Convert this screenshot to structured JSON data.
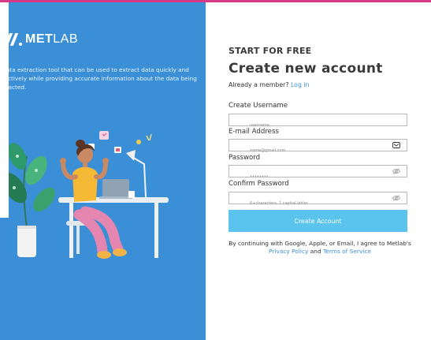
{
  "brand": {
    "logo_bold": "METLAB",
    "logo_light": "LAB",
    "tagline": "A data extraction tool that can be used to extract data quickly and effectively while providing accurate information about the data being extracted."
  },
  "form": {
    "kicker": "START FOR FREE",
    "title": "Create new account",
    "member_text": "Already a member?",
    "login_link": "Log in",
    "username_label": "Create Username",
    "username_placeholder": "username",
    "email_label": "E-mail Address",
    "email_placeholder": "name@gmail.com",
    "password_label": "Password",
    "password_value": "••••••••",
    "confirm_label": "Confirm Password",
    "confirm_placeholder": "6+characters, 1 capital letter",
    "submit_label": "Create Account",
    "legal_prefix": "By continuing with Google, Apple, or Email, I agree to Metlab's",
    "privacy_link": "Privacy Policy",
    "legal_and": "and",
    "terms_link": "Terms of Service"
  },
  "colors": {
    "left_panel": "#3b8fd6",
    "accent_bar": "#d63a84",
    "button": "#5ac4ee",
    "link": "#3b8fd6"
  }
}
